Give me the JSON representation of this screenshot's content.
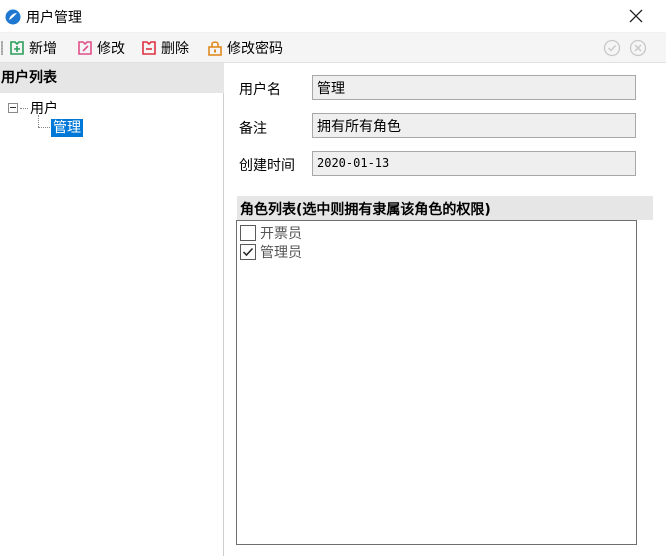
{
  "window": {
    "title": "用户管理"
  },
  "toolbar": {
    "add_label": "新增",
    "edit_label": "修改",
    "delete_label": "删除",
    "change_password_label": "修改密码"
  },
  "left_panel": {
    "header": "用户列表",
    "tree": {
      "root_label": "用户",
      "children": [
        "管理"
      ]
    }
  },
  "form": {
    "username_label": "用户名",
    "username_value": "管理",
    "remark_label": "备注",
    "remark_value": "拥有所有角色",
    "created_label": "创建时间",
    "created_value": "2020-01-13"
  },
  "roles": {
    "header": "角色列表(选中则拥有隶属该角色的权限)",
    "items": [
      {
        "label": "开票员",
        "checked": false
      },
      {
        "label": "管理员",
        "checked": true
      }
    ]
  },
  "colors": {
    "selection": "#0078d7",
    "icon_green": "#2aa05a",
    "icon_pink": "#e0508a",
    "icon_red": "#e03040",
    "icon_orange": "#e08a20"
  }
}
